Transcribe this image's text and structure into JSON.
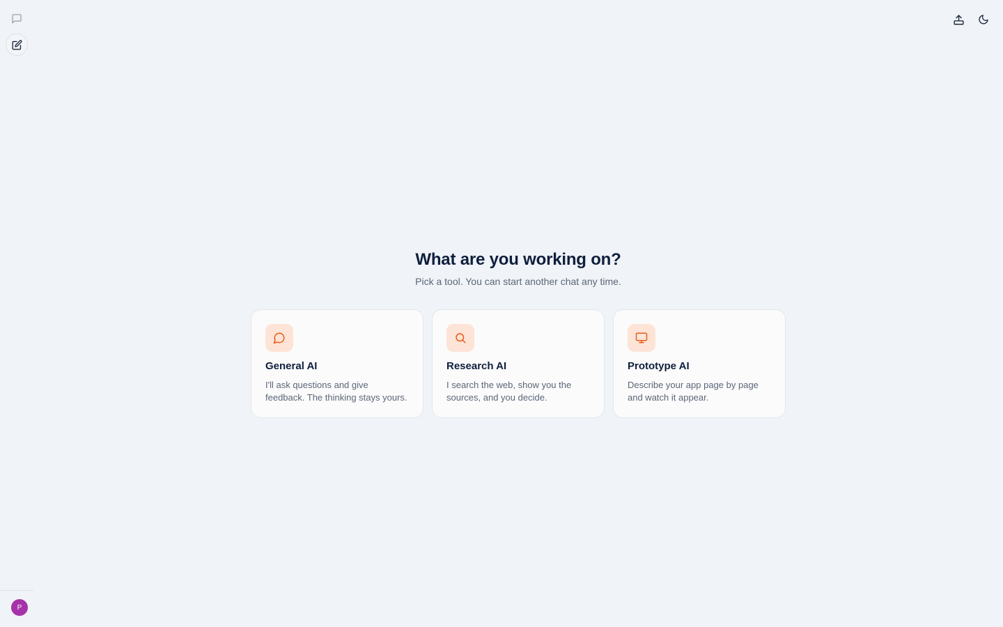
{
  "hero": {
    "title": "What are you working on?",
    "subtitle": "Pick a tool. You can start another chat any time."
  },
  "cards": [
    {
      "title": "General AI",
      "description": "I'll ask questions and give feedback. The thinking stays yours.",
      "icon": "chat-bubble-icon"
    },
    {
      "title": "Research AI",
      "description": "I search the web, show you the sources, and you decide.",
      "icon": "search-icon"
    },
    {
      "title": "Prototype AI",
      "description": "Describe your app page by page and watch it appear.",
      "icon": "monitor-icon"
    }
  ],
  "user": {
    "avatar_initial": "P"
  },
  "colors": {
    "accent": "#ea5a18",
    "accent_soft": "#fde4d7",
    "background": "#f0f3f7",
    "avatar": "#a532a8"
  }
}
